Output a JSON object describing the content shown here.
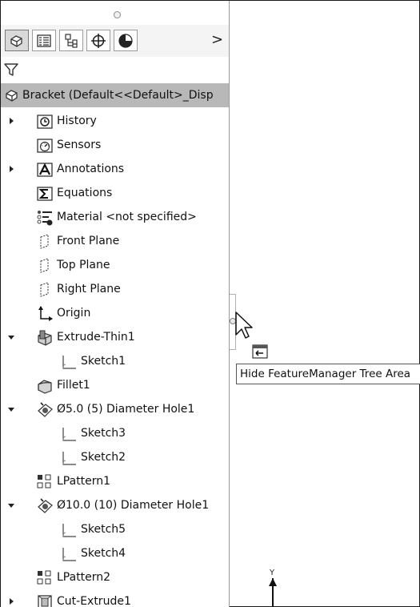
{
  "panel": {
    "tabs": [
      {
        "icon": "feature-manager-icon",
        "active": true
      },
      {
        "icon": "property-manager-icon",
        "active": false
      },
      {
        "icon": "configuration-manager-icon",
        "active": false
      },
      {
        "icon": "dimxpert-manager-icon",
        "active": false
      },
      {
        "icon": "display-manager-icon",
        "active": false
      }
    ],
    "more_label": ">",
    "root_label": "Bracket  (Default<<Default>_Disp"
  },
  "tree": [
    {
      "label": "History",
      "icon": "history-icon",
      "expander": "collapsed",
      "indent": 0
    },
    {
      "label": "Sensors",
      "icon": "sensors-icon",
      "expander": "none",
      "indent": 0
    },
    {
      "label": "Annotations",
      "icon": "annotations-icon",
      "expander": "collapsed",
      "indent": 0
    },
    {
      "label": "Equations",
      "icon": "equations-icon",
      "expander": "none",
      "indent": 0
    },
    {
      "label": "Material <not specified>",
      "icon": "material-icon",
      "expander": "none",
      "indent": 0
    },
    {
      "label": "Front Plane",
      "icon": "plane-icon",
      "expander": "none",
      "indent": 0
    },
    {
      "label": "Top Plane",
      "icon": "plane-icon",
      "expander": "none",
      "indent": 0
    },
    {
      "label": "Right Plane",
      "icon": "plane-icon",
      "expander": "none",
      "indent": 0
    },
    {
      "label": "Origin",
      "icon": "origin-icon",
      "expander": "none",
      "indent": 0
    },
    {
      "label": "Extrude-Thin1",
      "icon": "extrude-icon",
      "expander": "expanded",
      "indent": 0
    },
    {
      "label": "Sketch1",
      "icon": "sketch-icon",
      "expander": "none",
      "indent": 1
    },
    {
      "label": "Fillet1",
      "icon": "fillet-icon",
      "expander": "none",
      "indent": 0
    },
    {
      "label": "Ø5.0 (5) Diameter Hole1",
      "icon": "hole-icon",
      "expander": "expanded",
      "indent": 0
    },
    {
      "label": "Sketch3",
      "icon": "sketch-icon",
      "expander": "none",
      "indent": 1
    },
    {
      "label": "Sketch2",
      "icon": "sketch-icon",
      "expander": "none",
      "indent": 1
    },
    {
      "label": "LPattern1",
      "icon": "linear-pattern-icon",
      "expander": "none",
      "indent": 0
    },
    {
      "label": "Ø10.0 (10) Diameter Hole1",
      "icon": "hole-icon",
      "expander": "expanded",
      "indent": 0
    },
    {
      "label": "Sketch5",
      "icon": "sketch-icon",
      "expander": "none",
      "indent": 1
    },
    {
      "label": "Sketch4",
      "icon": "sketch-icon",
      "expander": "none",
      "indent": 1
    },
    {
      "label": "LPattern2",
      "icon": "linear-pattern-icon",
      "expander": "none",
      "indent": 0
    },
    {
      "label": "Cut-Extrude1",
      "icon": "cut-extrude-icon",
      "expander": "collapsed",
      "indent": 0
    }
  ],
  "tooltip": {
    "text": "Hide FeatureManager Tree Area"
  },
  "triad": {
    "axis_label": "Y"
  }
}
